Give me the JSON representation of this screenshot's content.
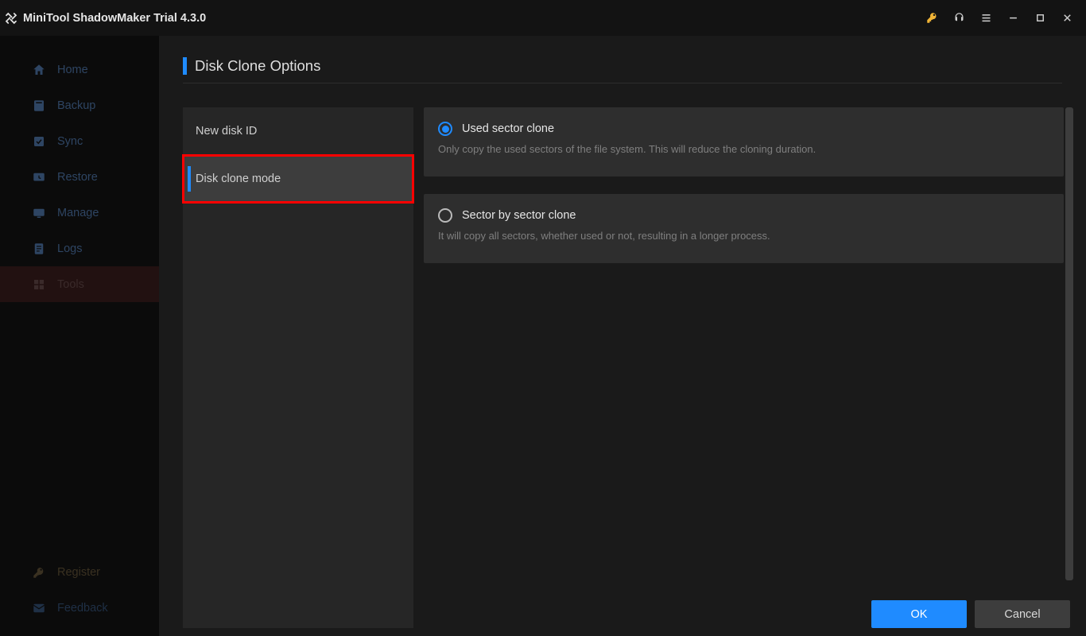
{
  "title": "MiniTool ShadowMaker Trial 4.3.0",
  "sidebar": {
    "nav": [
      {
        "label": "Home",
        "icon": "home"
      },
      {
        "label": "Backup",
        "icon": "backup"
      },
      {
        "label": "Sync",
        "icon": "sync"
      },
      {
        "label": "Restore",
        "icon": "restore"
      },
      {
        "label": "Manage",
        "icon": "manage"
      },
      {
        "label": "Logs",
        "icon": "logs"
      },
      {
        "label": "Tools",
        "icon": "tools"
      }
    ],
    "bottom": [
      {
        "label": "Register",
        "icon": "key"
      },
      {
        "label": "Feedback",
        "icon": "mail"
      }
    ]
  },
  "page": {
    "title": "Disk Clone Options",
    "option_tabs": [
      {
        "label": "New disk ID"
      },
      {
        "label": "Disk clone mode"
      }
    ],
    "modes": [
      {
        "title": "Used sector clone",
        "desc": "Only copy the used sectors of the file system. This will reduce the cloning duration.",
        "selected": true
      },
      {
        "title": "Sector by sector clone",
        "desc": "It will copy all sectors, whether used or not, resulting in a longer process.",
        "selected": false
      }
    ],
    "footer": {
      "ok": "OK",
      "cancel": "Cancel"
    }
  }
}
